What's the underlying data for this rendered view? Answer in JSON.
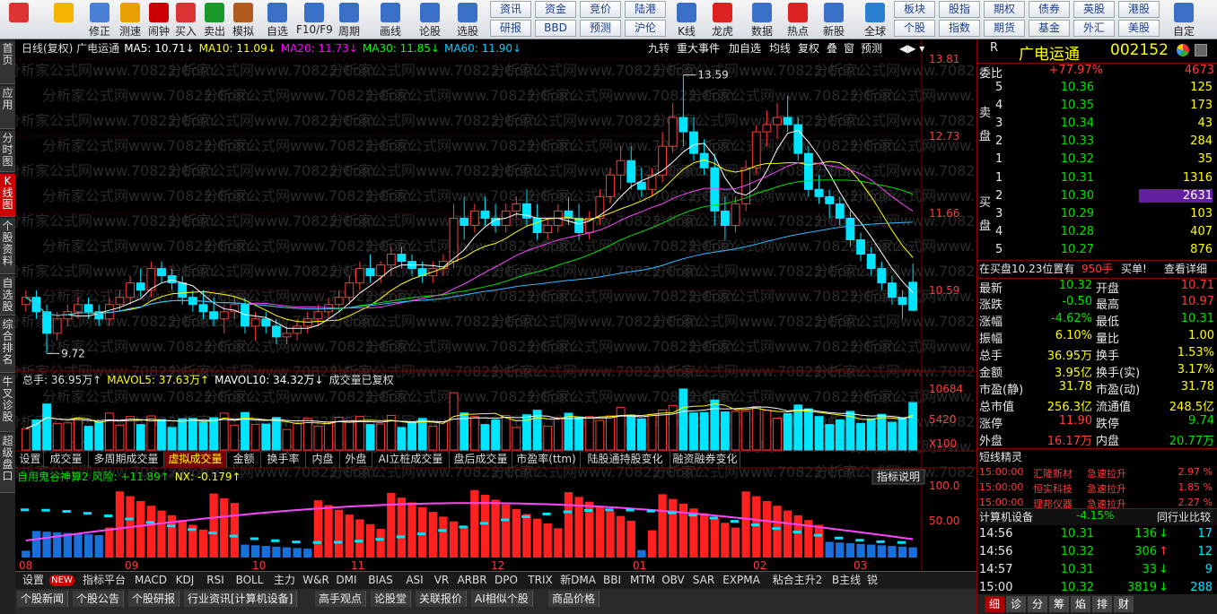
{
  "toolbar": {
    "buttons": [
      {
        "label": "",
        "icon": "grid-icon"
      },
      {
        "label": "",
        "icon": "back-arrow-icon"
      },
      {
        "label": "修正",
        "icon": "updown-icon"
      },
      {
        "label": "测速",
        "icon": "speed-icon"
      },
      {
        "label": "闹钟",
        "icon": "clock-icon"
      },
      {
        "label": "买入",
        "icon": "buy-icon"
      },
      {
        "label": "卖出",
        "icon": "sell-icon"
      },
      {
        "label": "模拟",
        "icon": "hammer-icon"
      },
      {
        "label": "自选",
        "icon": "watchlist-icon"
      },
      {
        "label": "F10/F9",
        "icon": "f10-icon"
      },
      {
        "label": "周期",
        "icon": "period-icon"
      },
      {
        "label": "画线",
        "icon": "pencil-icon"
      },
      {
        "label": "论股",
        "icon": "discuss-icon"
      },
      {
        "label": "选股",
        "icon": "select-icon"
      },
      {
        "label": "K线",
        "icon": "kline-icon"
      },
      {
        "label": "龙虎",
        "icon": "dragon-icon"
      },
      {
        "label": "数据",
        "icon": "pe-icon"
      },
      {
        "label": "热点",
        "icon": "hot-icon"
      },
      {
        "label": "新股",
        "icon": "newstock-icon"
      },
      {
        "label": "全球",
        "icon": "globe-icon"
      },
      {
        "label": "自定",
        "icon": "custom-icon"
      }
    ],
    "text_buttons_row1": [
      "资讯",
      "资金",
      "竞价",
      "陆港",
      "板块",
      "股指",
      "期权",
      "债券",
      "英股",
      "港股"
    ],
    "text_buttons_row2": [
      "研报",
      "BBD",
      "预测",
      "沪伦",
      "个股",
      "指数",
      "期货",
      "基金",
      "外汇",
      "美股"
    ]
  },
  "left_tabs": [
    "首页",
    "应用",
    "分时图",
    "K线图",
    "个股资料",
    "自选股",
    "综合排名",
    "牛叉诊股",
    "超级盘口"
  ],
  "kline_header": {
    "title": "日线(复权) 广电运通",
    "ma5": "MA5: 10.71↓",
    "ma10": "MA10: 11.09↓",
    "ma20": "MA20: 11.73↓",
    "ma30": "MA30: 11.85↓",
    "ma60": "MA60: 11.90↓"
  },
  "kline_tools": [
    "九转",
    "重大事件",
    "加自选",
    "均线",
    "复权",
    "叠",
    "窗",
    "预测"
  ],
  "price_axis": [
    "13.81",
    "12.73",
    "11.66",
    "10.59"
  ],
  "annotations": {
    "high": "13.59",
    "low": "9.72"
  },
  "volume_header": {
    "total": "总手: 36.95万↑",
    "mavol5": "MAVOL5: 37.63万↑",
    "mavol10": "MAVOL10: 34.32万↓",
    "note": "成交量已复权"
  },
  "volume_axis": [
    "10684",
    "5420",
    "X100"
  ],
  "subtabs": [
    "设置",
    "成交量",
    "多周期成交量",
    "虚拟成交量",
    "金额",
    "换手率",
    "内盘",
    "外盘",
    "AI立桩成交量",
    "盘后成交量",
    "市盈率(ttm)",
    "陆股通持股变化",
    "融资融券变化"
  ],
  "indicator_header": {
    "name": "自用鬼谷神算2 风险: +11.89↑",
    "nx": "NX: -0.179↑",
    "explain": "指标说明"
  },
  "indicator_axis": [
    "100.0",
    "50.00"
  ],
  "date_axis": [
    "08",
    "09",
    "10",
    "11",
    "12",
    "01",
    "02",
    "03"
  ],
  "bottom_tabs": [
    "设置",
    "指标平台",
    "MACD",
    "KDJ",
    "RSI",
    "BOLL",
    "主力",
    "W&R",
    "DMI",
    "BIAS",
    "ASI",
    "VR",
    "ARBR",
    "DPO",
    "TRIX",
    "新DMA",
    "BBI",
    "MTM",
    "OBV",
    "SAR",
    "EXPMA",
    "粘合主升2",
    "B主线",
    "锐"
  ],
  "new_badge": "NEW",
  "bottom_tabs2": [
    "个股新闻",
    "个股公告",
    "个股研报",
    "行业资讯[计算机设备]",
    "高手观点",
    "论股堂",
    "关联报价",
    "AI相似个股",
    "商品价格"
  ],
  "watermark": "分析家公式网www.70822.Com",
  "quote": {
    "code_label": "R",
    "name": "广电运通",
    "code": "002152",
    "weibi_label": "委比",
    "weibi": "+77.97%",
    "weicha": "4673",
    "sell_label": "卖盘",
    "buy_label": "买盘",
    "asks": [
      {
        "lv": "5",
        "p": "10.36",
        "v": "125"
      },
      {
        "lv": "4",
        "p": "10.35",
        "v": "173"
      },
      {
        "lv": "3",
        "p": "10.34",
        "v": "43"
      },
      {
        "lv": "2",
        "p": "10.33",
        "v": "284"
      },
      {
        "lv": "1",
        "p": "10.32",
        "v": "35"
      }
    ],
    "bids": [
      {
        "lv": "1",
        "p": "10.31",
        "v": "1316"
      },
      {
        "lv": "2",
        "p": "10.30",
        "v": "2631"
      },
      {
        "lv": "3",
        "p": "10.29",
        "v": "103"
      },
      {
        "lv": "4",
        "p": "10.28",
        "v": "407"
      },
      {
        "lv": "5",
        "p": "10.27",
        "v": "876"
      }
    ],
    "notice": "在买盘10.23位置有",
    "notice_vol": "950手",
    "notice_tag": "买单!",
    "notice_link": "查看详细",
    "stats": [
      [
        "最新",
        "10.32",
        "开盘",
        "10.71"
      ],
      [
        "涨跌",
        "-0.50",
        "最高",
        "10.97"
      ],
      [
        "涨幅",
        "-4.62%",
        "最低",
        "10.31"
      ],
      [
        "振幅",
        "6.10%",
        "量比",
        "1.00"
      ],
      [
        "总手",
        "36.95万",
        "换手",
        "1.53%"
      ],
      [
        "金额",
        "3.95亿",
        "换手(实)",
        "3.17%"
      ],
      [
        "市盈(静)",
        "31.78",
        "市盈(动)",
        "31.78"
      ],
      [
        "总市值",
        "256.3亿",
        "流通值",
        "248.5亿"
      ],
      [
        "涨停",
        "11.90",
        "跌停",
        "9.74"
      ],
      [
        "外盘",
        "16.17万",
        "内盘",
        "20.77万"
      ]
    ],
    "jingling_title": "短线精灵",
    "jingling": [
      [
        "15:00:00",
        "汇隆新材",
        "急速拉升",
        "2.97 %"
      ],
      [
        "15:00:00",
        "恒实科技",
        "急速拉升",
        "1.85 %"
      ],
      [
        "15:00:00",
        "理邦仪器",
        "急速拉升",
        "2.27 %"
      ]
    ],
    "industry": "计算机设备",
    "industry_chg": "-4.15%",
    "industry_link": "同行业比较",
    "ticks": [
      [
        "14:56",
        "10.31",
        "136",
        "↓",
        "17"
      ],
      [
        "14:56",
        "10.32",
        "306",
        "↑",
        "12"
      ],
      [
        "14:57",
        "10.31",
        "33",
        "↓",
        "9"
      ],
      [
        "15:00",
        "10.32",
        "3819",
        "↓",
        "288"
      ]
    ],
    "bottom_tabs": [
      "细",
      "诊",
      "分",
      "筹",
      "焰",
      "排",
      "财"
    ]
  },
  "chart_data": {
    "type": "candlestick",
    "ylim": [
      9.5,
      13.81
    ],
    "candles": [
      [
        10.4,
        10.6,
        10.3,
        10.5
      ],
      [
        10.5,
        10.6,
        10.2,
        10.3
      ],
      [
        10.3,
        10.4,
        9.72,
        10.0
      ],
      [
        10.0,
        10.3,
        9.9,
        10.2
      ],
      [
        10.2,
        10.4,
        10.1,
        10.3
      ],
      [
        10.3,
        10.5,
        10.2,
        10.4
      ],
      [
        10.4,
        10.5,
        10.2,
        10.3
      ],
      [
        10.3,
        10.4,
        10.1,
        10.2
      ],
      [
        10.2,
        10.5,
        10.1,
        10.4
      ],
      [
        10.4,
        10.6,
        10.3,
        10.5
      ],
      [
        10.5,
        10.8,
        10.4,
        10.7
      ],
      [
        10.7,
        10.9,
        10.5,
        10.6
      ],
      [
        10.6,
        11.0,
        10.5,
        10.9
      ],
      [
        10.9,
        11.0,
        10.7,
        10.8
      ],
      [
        10.8,
        10.9,
        10.6,
        10.7
      ],
      [
        10.7,
        10.8,
        10.4,
        10.5
      ],
      [
        10.5,
        10.6,
        10.3,
        10.4
      ],
      [
        10.4,
        10.6,
        10.2,
        10.3
      ],
      [
        10.3,
        10.5,
        10.1,
        10.2
      ],
      [
        10.2,
        10.4,
        10.0,
        10.3
      ],
      [
        10.3,
        10.5,
        10.2,
        10.4
      ],
      [
        10.4,
        10.5,
        10.0,
        10.1
      ],
      [
        10.1,
        10.3,
        9.9,
        10.2
      ],
      [
        10.2,
        10.3,
        10.0,
        10.1
      ],
      [
        10.1,
        10.2,
        9.85,
        9.95
      ],
      [
        9.95,
        10.1,
        9.85,
        10.0
      ],
      [
        10.0,
        10.2,
        9.9,
        10.1
      ],
      [
        10.1,
        10.3,
        10.0,
        10.2
      ],
      [
        10.2,
        10.4,
        10.1,
        10.3
      ],
      [
        10.3,
        10.5,
        10.2,
        10.4
      ],
      [
        10.4,
        10.6,
        10.3,
        10.5
      ],
      [
        10.5,
        10.8,
        10.4,
        10.7
      ],
      [
        10.7,
        11.0,
        10.6,
        10.9
      ],
      [
        10.9,
        11.1,
        10.7,
        10.8
      ],
      [
        10.8,
        11.0,
        10.7,
        10.95
      ],
      [
        10.95,
        11.2,
        10.8,
        11.1
      ],
      [
        11.1,
        11.2,
        10.9,
        11.0
      ],
      [
        11.0,
        11.1,
        10.8,
        10.9
      ],
      [
        10.9,
        11.0,
        10.7,
        10.8
      ],
      [
        10.8,
        11.0,
        10.7,
        10.9
      ],
      [
        10.9,
        11.1,
        10.8,
        11.0
      ],
      [
        11.0,
        11.8,
        10.9,
        11.6
      ],
      [
        11.6,
        11.9,
        11.3,
        11.5
      ],
      [
        11.5,
        11.8,
        11.4,
        11.7
      ],
      [
        11.7,
        11.9,
        11.5,
        11.6
      ],
      [
        11.6,
        11.8,
        11.4,
        11.5
      ],
      [
        11.5,
        11.8,
        11.4,
        11.7
      ],
      [
        11.7,
        11.9,
        11.6,
        11.8
      ],
      [
        11.8,
        12.0,
        11.5,
        11.6
      ],
      [
        11.6,
        11.8,
        11.3,
        11.4
      ],
      [
        11.4,
        11.6,
        11.3,
        11.5
      ],
      [
        11.5,
        11.8,
        11.4,
        11.7
      ],
      [
        11.7,
        11.9,
        11.5,
        11.6
      ],
      [
        11.6,
        11.8,
        11.3,
        11.4
      ],
      [
        11.4,
        11.7,
        11.3,
        11.6
      ],
      [
        11.6,
        12.0,
        11.5,
        11.9
      ],
      [
        11.9,
        12.3,
        11.8,
        12.2
      ],
      [
        12.2,
        12.6,
        12.0,
        12.4
      ],
      [
        12.4,
        12.6,
        12.0,
        12.1
      ],
      [
        12.1,
        12.3,
        11.9,
        12.0
      ],
      [
        12.0,
        12.3,
        11.9,
        12.2
      ],
      [
        12.2,
        12.8,
        12.1,
        12.6
      ],
      [
        12.6,
        13.2,
        12.5,
        13.0
      ],
      [
        13.0,
        13.59,
        12.6,
        12.8
      ],
      [
        12.8,
        13.0,
        12.4,
        12.5
      ],
      [
        12.5,
        12.7,
        12.2,
        12.3
      ],
      [
        12.3,
        12.5,
        11.5,
        11.7
      ],
      [
        11.7,
        11.9,
        11.3,
        11.5
      ],
      [
        11.5,
        11.9,
        11.4,
        11.8
      ],
      [
        11.8,
        12.4,
        11.7,
        12.3
      ],
      [
        12.3,
        12.9,
        12.2,
        12.8
      ],
      [
        12.8,
        13.1,
        12.6,
        12.9
      ],
      [
        12.9,
        13.2,
        12.7,
        13.0
      ],
      [
        13.0,
        13.3,
        12.8,
        12.9
      ],
      [
        12.9,
        13.0,
        12.4,
        12.5
      ],
      [
        12.5,
        12.6,
        11.9,
        12.0
      ],
      [
        12.0,
        12.2,
        11.8,
        11.9
      ],
      [
        11.9,
        12.0,
        11.6,
        11.8
      ],
      [
        11.8,
        11.9,
        11.5,
        11.6
      ],
      [
        11.6,
        11.7,
        11.2,
        11.3
      ],
      [
        11.3,
        11.4,
        11.0,
        11.1
      ],
      [
        11.1,
        11.2,
        10.8,
        10.9
      ],
      [
        10.9,
        11.0,
        10.6,
        10.7
      ],
      [
        10.7,
        10.8,
        10.4,
        10.5
      ],
      [
        10.5,
        10.6,
        10.2,
        10.4
      ],
      [
        10.71,
        10.97,
        10.31,
        10.32
      ]
    ]
  }
}
